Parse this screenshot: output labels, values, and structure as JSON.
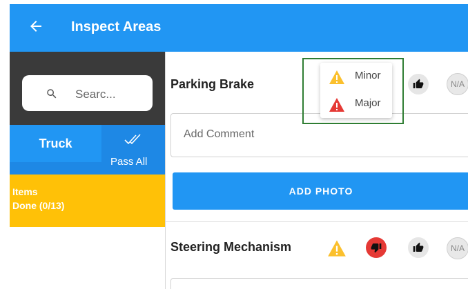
{
  "appbar": {
    "title": "Inspect Areas",
    "back_icon": "arrow-left-icon"
  },
  "sidebar": {
    "search": {
      "placeholder": "Searc..."
    },
    "tab_truck": "Truck",
    "pass_all": "Pass All",
    "items_label": "Items",
    "items_done": "Done (0/13)"
  },
  "inspection_items": [
    {
      "title": "Parking Brake",
      "comment_placeholder": "Add Comment",
      "add_photo": "ADD PHOTO",
      "na_label": "N/A"
    },
    {
      "title": "Steering Mechanism",
      "na_label": "N/A"
    }
  ],
  "defect_menu": {
    "options": [
      {
        "label": "Minor",
        "color": "#fbc02d"
      },
      {
        "label": "Major",
        "color": "#e53935"
      }
    ]
  },
  "colors": {
    "primary": "#2196f3",
    "amber": "#ffc107",
    "danger": "#e53935",
    "highlight": "#2e7d32"
  }
}
